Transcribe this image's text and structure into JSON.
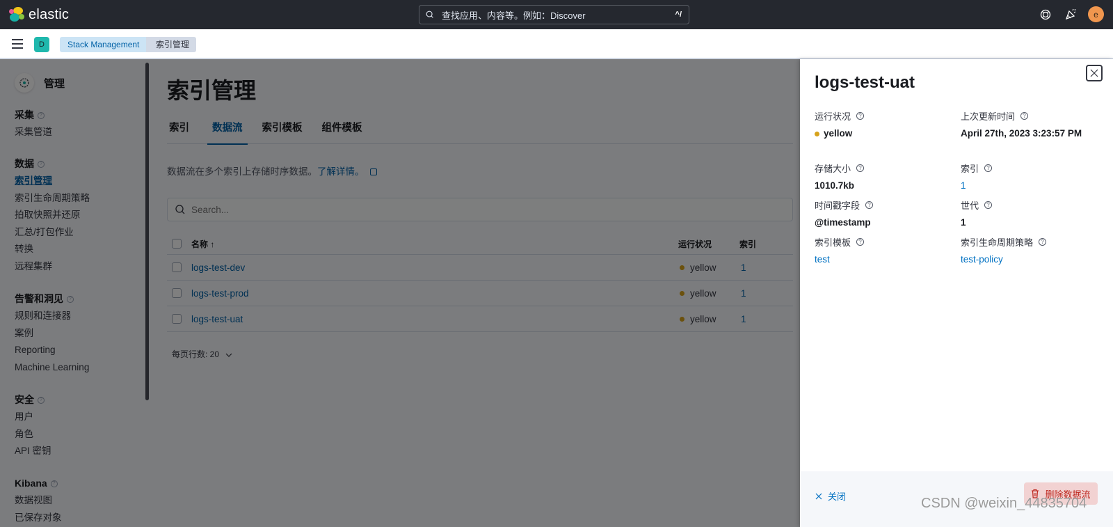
{
  "header": {
    "brand": "elastic",
    "search_placeholder": "查找应用、内容等。例如：Discover",
    "search_shortcut": "^/",
    "user_initial": "e"
  },
  "subheader": {
    "space_initial": "D",
    "breadcrumbs": [
      "Stack Management",
      "索引管理"
    ]
  },
  "sidebar": {
    "title": "管理",
    "groups": [
      {
        "title": "采集",
        "items": [
          "采集管道"
        ]
      },
      {
        "title": "数据",
        "items": [
          "索引管理",
          "索引生命周期策略",
          "拍取快照并还原",
          "汇总/打包作业",
          "转换",
          "远程集群"
        ],
        "active": "索引管理"
      },
      {
        "title": "告警和洞见",
        "items": [
          "规则和连接器",
          "案例",
          "Reporting",
          "Machine Learning"
        ]
      },
      {
        "title": "安全",
        "items": [
          "用户",
          "角色",
          "API 密钥"
        ]
      },
      {
        "title": "Kibana",
        "items": [
          "数据视图",
          "已保存对象"
        ]
      }
    ]
  },
  "main": {
    "title": "索引管理",
    "tabs": [
      {
        "label": "索引",
        "active": false
      },
      {
        "label": "数据流",
        "active": true
      },
      {
        "label": "索引模板",
        "active": false
      },
      {
        "label": "组件模板",
        "active": false
      }
    ],
    "description": "数据流在多个索引上存储时序数据。",
    "learn_more": "了解详情。",
    "search_placeholder": "Search...",
    "table": {
      "columns": {
        "name": "名称",
        "sort": "↑",
        "status": "运行状况",
        "indices": "索引"
      },
      "rows": [
        {
          "name": "logs-test-dev",
          "status": "yellow",
          "indices": "1"
        },
        {
          "name": "logs-test-prod",
          "status": "yellow",
          "indices": "1"
        },
        {
          "name": "logs-test-uat",
          "status": "yellow",
          "indices": "1"
        }
      ]
    },
    "rows_per_page": "每页行数: 20"
  },
  "flyout": {
    "title": "logs-test-uat",
    "fields": {
      "health": {
        "label": "运行状况",
        "value": "yellow"
      },
      "last_updated": {
        "label": "上次更新时间",
        "value": "April 27th, 2023 3:23:57 PM"
      },
      "storage_size": {
        "label": "存储大小",
        "value": "1010.7kb"
      },
      "indices": {
        "label": "索引",
        "value": "1"
      },
      "timestamp_field": {
        "label": "时间戳字段",
        "value": "@timestamp"
      },
      "generation": {
        "label": "世代",
        "value": "1"
      },
      "index_template": {
        "label": "索引模板",
        "value": "test"
      },
      "ilm_policy": {
        "label": "索引生命周期策略",
        "value": "test-policy"
      }
    },
    "close_label": "关闭",
    "delete_label": "删除数据流"
  },
  "colors": {
    "status_yellow": "#d6a21b",
    "link": "#0071c2",
    "danger": "#bd271e",
    "header_bg": "#25282f"
  },
  "watermark": "CSDN @weixin_44835704"
}
